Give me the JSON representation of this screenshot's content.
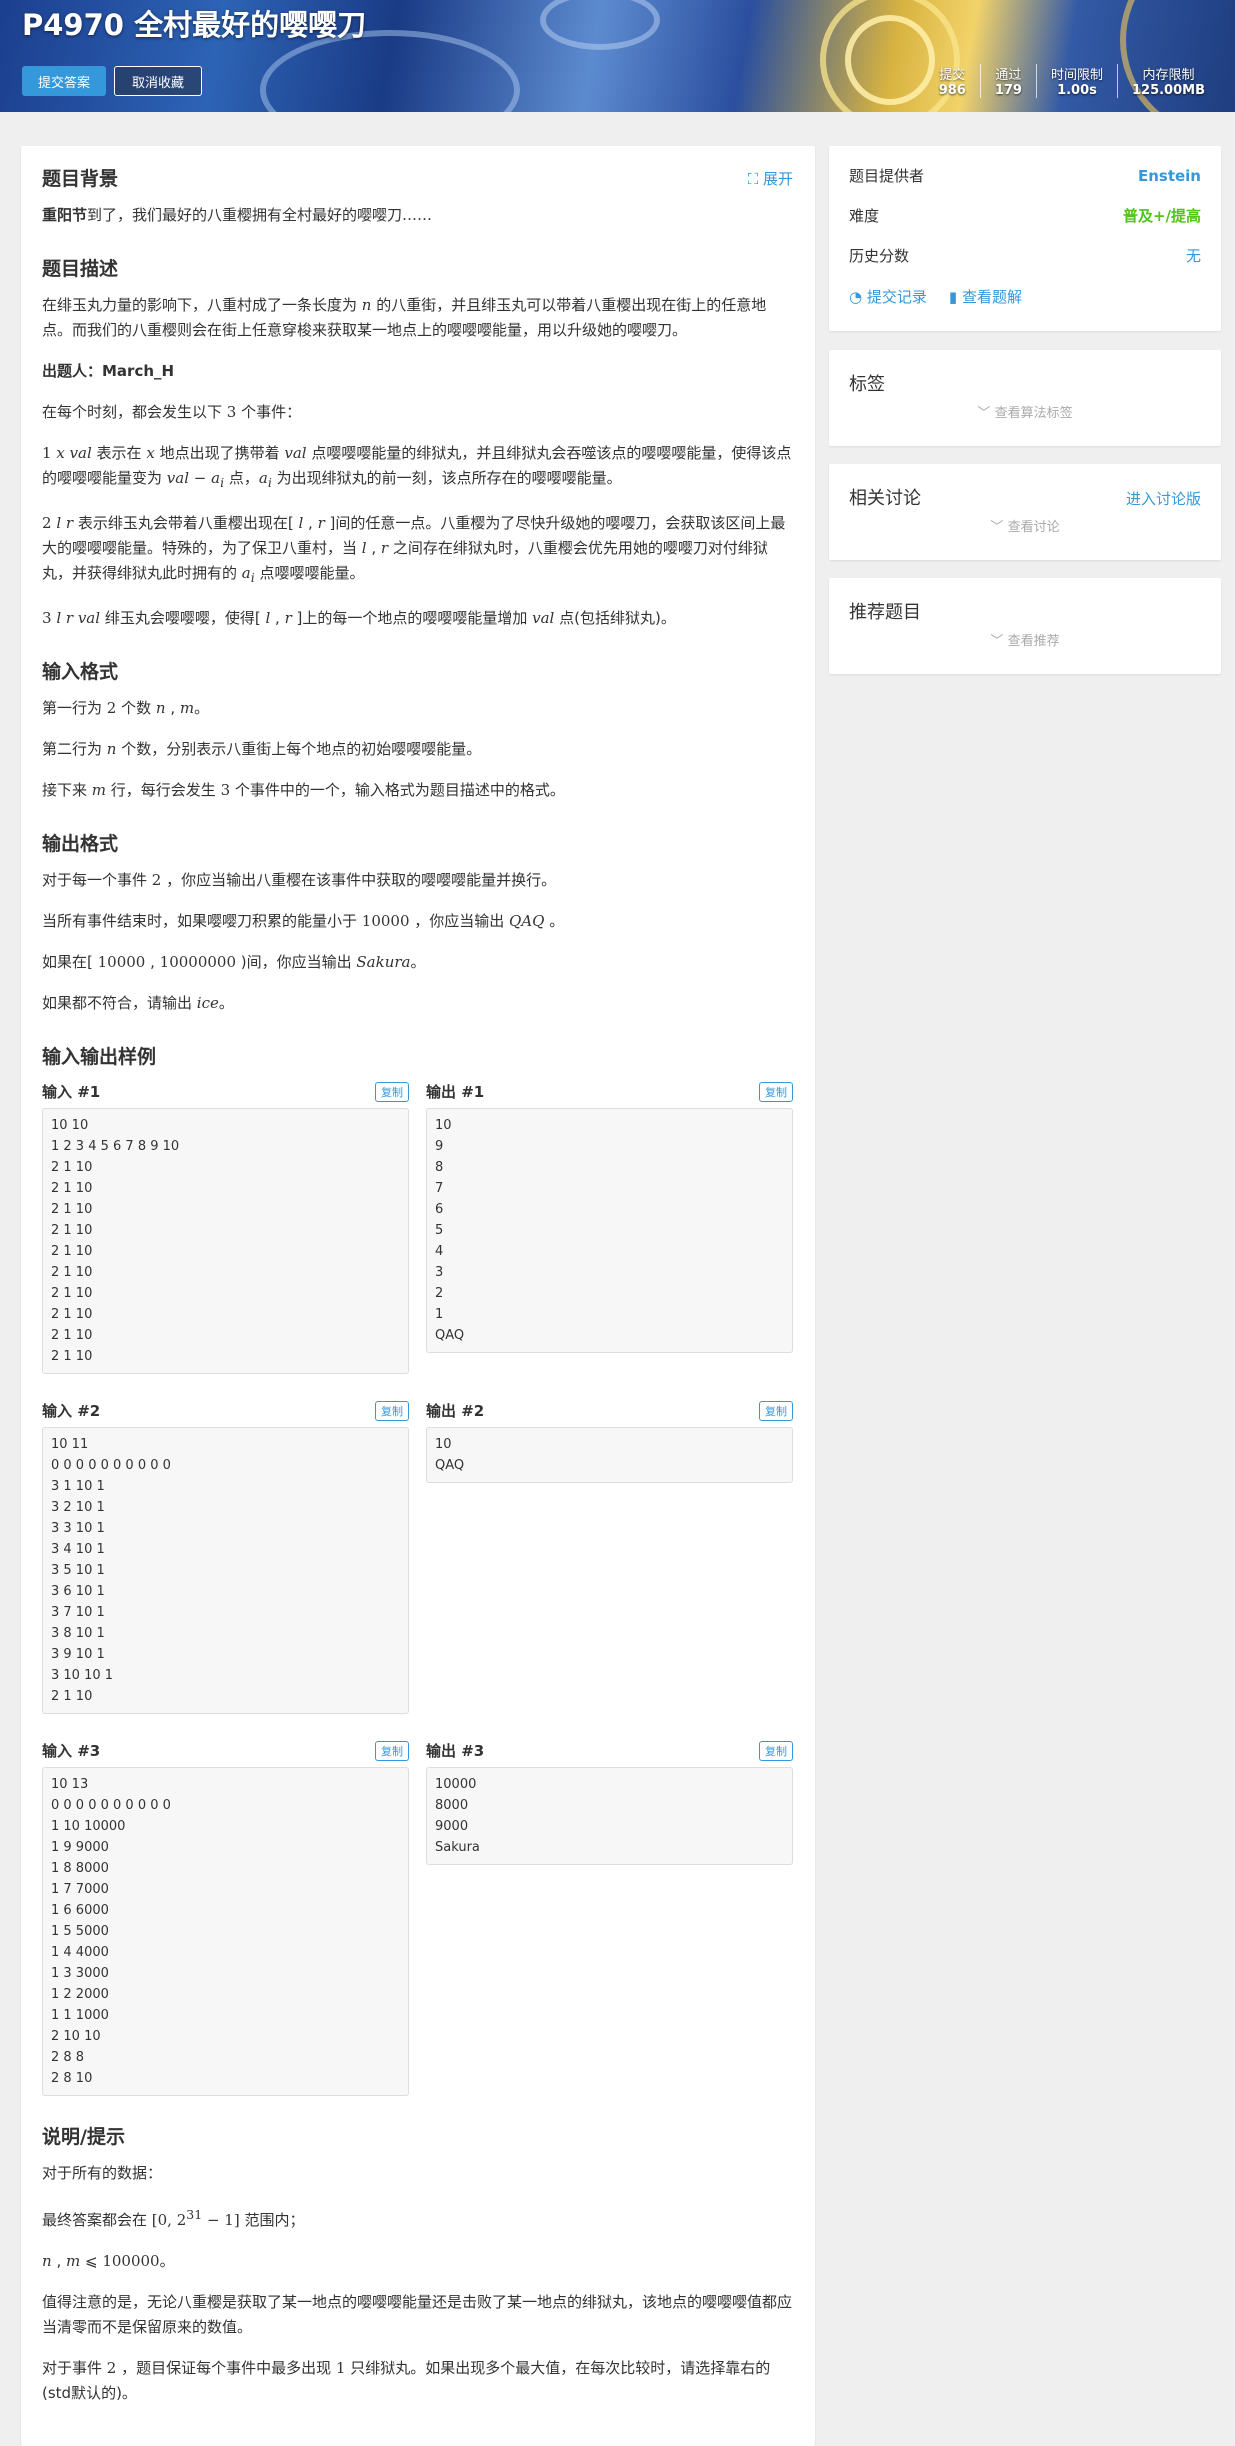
{
  "header": {
    "title": "P4970 全村最好的嘤嘤刀",
    "submit_label": "提交答案",
    "unfavorite_label": "取消收藏",
    "stats": [
      {
        "key": "提交",
        "value": "986"
      },
      {
        "key": "通过",
        "value": "179"
      },
      {
        "key": "时间限制",
        "value": "1.00s"
      },
      {
        "key": "内存限制",
        "value": "125.00MB"
      }
    ]
  },
  "main": {
    "expand_label": "展开",
    "background_title": "题目背景",
    "background_bold": "重阳节",
    "background_text": "到了，我们最好的八重樱拥有全村最好的嘤嘤刀……",
    "desc_title": "题目描述",
    "input_title": "输入格式",
    "output_title": "输出格式",
    "samples_title": "输入输出样例",
    "hint_title": "说明/提示",
    "copy_label": "复制"
  },
  "samples": [
    {
      "in_label": "输入 #1",
      "in": "10 10\n1 2 3 4 5 6 7 8 9 10\n2 1 10\n2 1 10\n2 1 10\n2 1 10\n2 1 10\n2 1 10\n2 1 10\n2 1 10\n2 1 10\n2 1 10",
      "out_label": "输出 #1",
      "out": "10\n9\n8\n7\n6\n5\n4\n3\n2\n1\nQAQ"
    },
    {
      "in_label": "输入 #2",
      "in": "10 11\n0 0 0 0 0 0 0 0 0 0\n3 1 10 1\n3 2 10 1\n3 3 10 1\n3 4 10 1\n3 5 10 1\n3 6 10 1\n3 7 10 1\n3 8 10 1\n3 9 10 1\n3 10 10 1\n2 1 10",
      "out_label": "输出 #2",
      "out": "10\nQAQ"
    },
    {
      "in_label": "输入 #3",
      "in": "10 13\n0 0 0 0 0 0 0 0 0 0\n1 10 10000\n1 9 9000\n1 8 8000\n1 7 7000\n1 6 6000\n1 5 5000\n1 4 4000\n1 3 3000\n1 2 2000\n1 1 1000\n2 10 10\n2 8 8\n2 8 10",
      "out_label": "输出 #3",
      "out": "10000\n8000\n9000\nSakura"
    }
  ],
  "sidebar": {
    "provider_label": "题目提供者",
    "provider_value": "Enstein",
    "difficulty_label": "难度",
    "difficulty_value": "普及+/提高",
    "history_label": "历史分数",
    "history_value": "无",
    "records_link": "提交记录",
    "solution_link": "查看题解",
    "tags_title": "标签",
    "tags_more": "查看算法标签",
    "discuss_title": "相关讨论",
    "discuss_link": "进入讨论版",
    "discuss_more": "查看讨论",
    "recommend_title": "推荐题目",
    "recommend_more": "查看推荐"
  },
  "colors": {
    "accent": "#3498db",
    "difficulty": "#52c41a"
  }
}
